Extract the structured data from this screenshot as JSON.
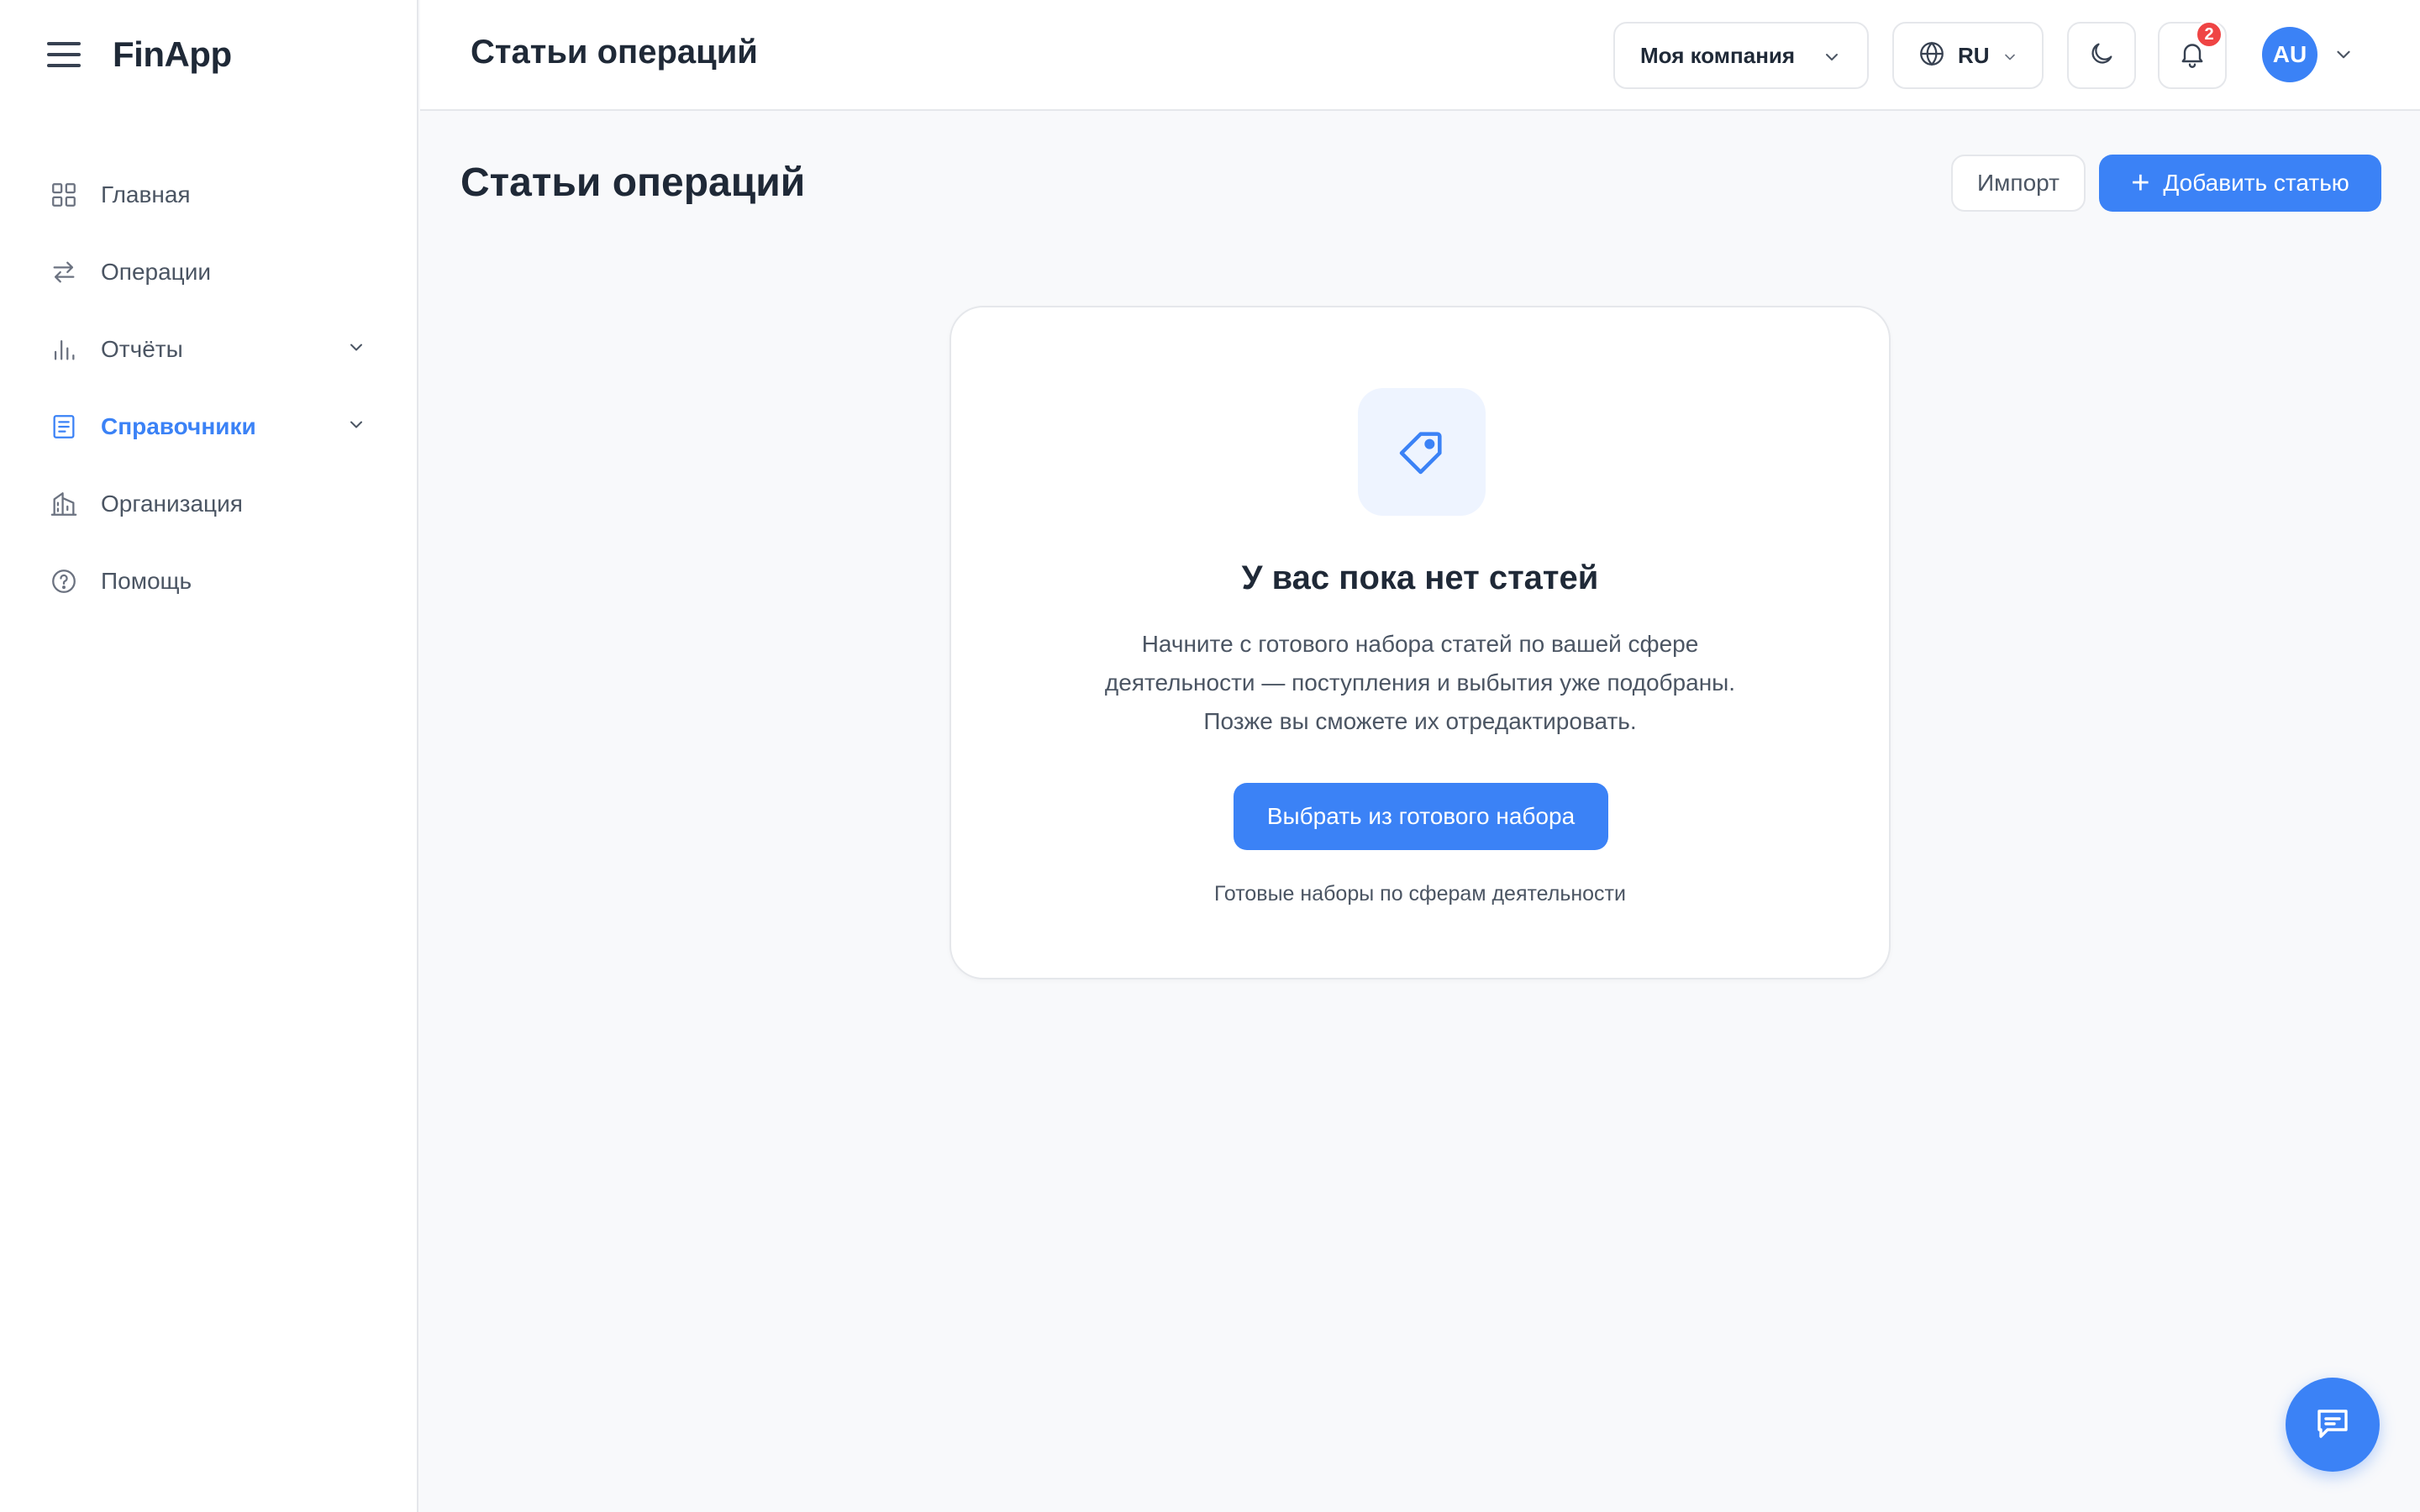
{
  "app": {
    "logo": "FinApp"
  },
  "sidebar": {
    "items": [
      {
        "label": "Главная",
        "icon": "grid-icon"
      },
      {
        "label": "Операции",
        "icon": "arrows-swap-icon"
      },
      {
        "label": "Отчёты",
        "icon": "bar-chart-icon",
        "expandable": true
      },
      {
        "label": "Справочники",
        "icon": "book-icon",
        "expandable": true,
        "active": true
      },
      {
        "label": "Организация",
        "icon": "building-icon"
      },
      {
        "label": "Помощь",
        "icon": "help-circle-icon"
      }
    ]
  },
  "topbar": {
    "title": "Статьи операций",
    "company": "Моя компания",
    "language": "RU",
    "notifications_count": "2",
    "avatar_initials": "AU"
  },
  "main": {
    "title": "Статьи операций",
    "import_label": "Импорт",
    "add_label": "Добавить статью"
  },
  "empty_state": {
    "title": "У вас пока нет статей",
    "description_lines": [
      "Начните с готового набора статей по вашей сфере",
      "деятельности — поступления и выбытия уже подобраны.",
      "Позже вы сможете их отредактировать."
    ],
    "button_label": "Выбрать из готового набора",
    "link_label": "Готовые наборы по сферам деятельности"
  },
  "colors": {
    "accent": "#3b82f6",
    "badge": "#ef4444",
    "icon_bg": "#eef4ff"
  }
}
